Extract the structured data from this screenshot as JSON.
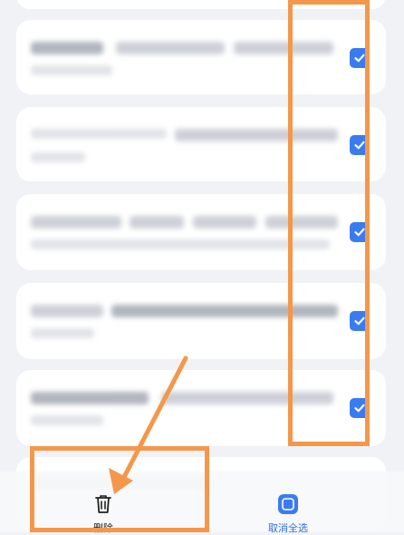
{
  "list": {
    "items": [
      {
        "checked": true,
        "text_blurred": true
      },
      {
        "checked": true,
        "text_blurred": true
      },
      {
        "checked": true,
        "text_blurred": true
      },
      {
        "checked": true,
        "text_blurred": true
      },
      {
        "checked": true,
        "text_blurred": true
      }
    ]
  },
  "bottom_bar": {
    "delete_label": "删除",
    "delete_icon": "trash-icon",
    "select_all_label": "取消全选",
    "select_all_icon": "checkbox-icon"
  },
  "colors": {
    "accent": "#3a7cf0",
    "annotation": "#f5974a",
    "background": "#f1f2f5",
    "card": "#ffffff"
  }
}
